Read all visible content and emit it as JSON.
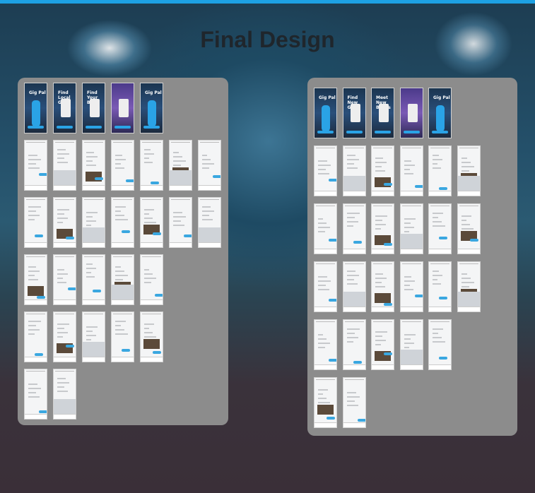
{
  "page": {
    "title": "Final Design"
  },
  "colors": {
    "accent": "#1da1e4",
    "panel": "#8c8c8c"
  },
  "left_panel": {
    "hero_labels": [
      "Gig Pal",
      "Find Local Gigs",
      "Find Your Band",
      "",
      "Gig Pal"
    ]
  },
  "right_panel": {
    "hero_labels": [
      "Gig Pal",
      "Find New Gigs",
      "Meet New Bands",
      "",
      "Gig Pal"
    ]
  }
}
